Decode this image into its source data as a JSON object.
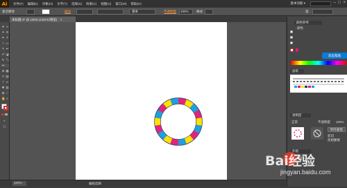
{
  "app": {
    "logo": "Ai",
    "workspace": "基本功能 ▾"
  },
  "menus": [
    "文件(F)",
    "编辑(E)",
    "对象(O)",
    "文字(T)",
    "选择(S)",
    "效果(C)",
    "视图(V)",
    "窗口(W)",
    "帮助(H)"
  ],
  "control_bar": {
    "selection_label": "复合路径",
    "stroke_label": "描边",
    "opacity_label": "不透明度",
    "opacity_value": "100%",
    "style_label": "样式",
    "width_label": "宽",
    "brush_value": "基本"
  },
  "document_tab": {
    "label": "未标题-2* @ 100% (CMYK/预览)",
    "close": "×"
  },
  "status_bar": {
    "zoom": "100%",
    "status_text": "编组选择"
  },
  "right_dock": {
    "color_tab": "颜色参考",
    "brush_tab": "画笔",
    "transparency_tab": "透明度",
    "blend_mode": "正常",
    "opacity_label": "不透明度",
    "opacity_value": "100%",
    "make_mask_label": "制作蒙版",
    "clip_label": "剪切",
    "invert_label": "反相蒙版",
    "appearance_tab": "外观",
    "appearance_label": "编组",
    "help_badge": "双击帮助",
    "color_panel_title": "颜色"
  },
  "ring": {
    "colors": [
      "#e0247e",
      "#ffe100",
      "#1ea0dc"
    ],
    "outline": "#3a3a6a"
  },
  "watermark": {
    "logo": "Bai经验",
    "site": "jingyan.baidu.com"
  }
}
